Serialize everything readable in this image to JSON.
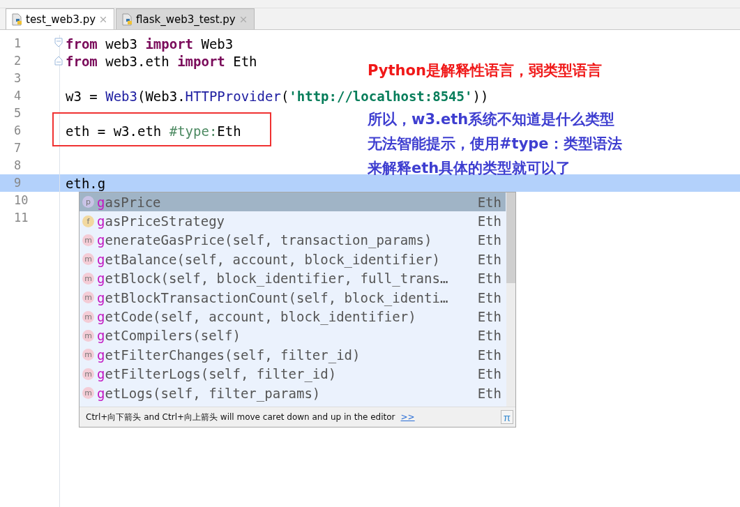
{
  "tabs": [
    {
      "label": "test_web3.py",
      "selected": true
    },
    {
      "label": "flask_web3_test.py",
      "selected": false
    }
  ],
  "editor": {
    "lines": [
      {
        "number": "1",
        "current": false,
        "tokens": [
          {
            "kind": "keyword",
            "text": "from"
          },
          {
            "kind": "plain",
            "text": " web3 "
          },
          {
            "kind": "keyword",
            "text": "import"
          },
          {
            "kind": "plain",
            "text": " Web3"
          }
        ]
      },
      {
        "number": "2",
        "current": false,
        "tokens": [
          {
            "kind": "keyword",
            "text": "from"
          },
          {
            "kind": "plain",
            "text": " web3.eth "
          },
          {
            "kind": "keyword",
            "text": "import"
          },
          {
            "kind": "plain",
            "text": " Eth"
          }
        ]
      },
      {
        "number": "3",
        "current": false
      },
      {
        "number": "4",
        "current": false,
        "tokens": [
          {
            "kind": "plain",
            "text": "w3 = "
          },
          {
            "kind": "call",
            "text": "Web3"
          },
          {
            "kind": "plain",
            "text": "(Web3."
          },
          {
            "kind": "call",
            "text": "HTTPProvider"
          },
          {
            "kind": "plain",
            "text": "("
          },
          {
            "kind": "string",
            "text": "'http://localhost:8545'"
          },
          {
            "kind": "plain",
            "text": "))"
          }
        ]
      },
      {
        "number": "5",
        "current": false
      },
      {
        "number": "6",
        "current": false,
        "tokens": [
          {
            "kind": "plain",
            "text": "eth = w3.eth "
          },
          {
            "kind": "comment",
            "text": "#type:"
          },
          {
            "kind": "plain",
            "text": "Eth"
          }
        ]
      },
      {
        "number": "7",
        "current": false
      },
      {
        "number": "8",
        "current": false
      },
      {
        "number": "9",
        "current": true,
        "tokens": [
          {
            "kind": "plain",
            "text": "eth.g"
          }
        ]
      },
      {
        "number": "10",
        "current": false
      },
      {
        "number": "11",
        "current": false
      }
    ]
  },
  "annotations": [
    {
      "kind": "heading",
      "text": "Python是解释性语言，弱类型语言"
    },
    {
      "kind": "note",
      "text": "所以，w3.eth系统不知道是什么类型"
    },
    {
      "kind": "note",
      "text": "无法智能提示，使用#type：类型语法"
    },
    {
      "kind": "note",
      "text": "来解释eth具体的类型就可以了"
    }
  ],
  "completion": {
    "items": [
      {
        "kind": "p",
        "match": "g",
        "rest": "asPrice",
        "type": "Eth",
        "selected": true
      },
      {
        "kind": "f",
        "match": "g",
        "rest": "asPriceStrategy",
        "type": "Eth",
        "selected": false
      },
      {
        "kind": "m",
        "match": "g",
        "rest": "enerateGasPrice(self, transaction_params)",
        "type": "Eth",
        "selected": false
      },
      {
        "kind": "m",
        "match": "g",
        "rest": "etBalance(self, account, block_identifier)",
        "type": "Eth",
        "selected": false
      },
      {
        "kind": "m",
        "match": "g",
        "rest": "etBlock(self, block_identifier, full_trans…",
        "type": "Eth",
        "selected": false
      },
      {
        "kind": "m",
        "match": "g",
        "rest": "etBlockTransactionCount(self, block_identi…",
        "type": "Eth",
        "selected": false
      },
      {
        "kind": "m",
        "match": "g",
        "rest": "etCode(self, account, block_identifier)",
        "type": "Eth",
        "selected": false
      },
      {
        "kind": "m",
        "match": "g",
        "rest": "etCompilers(self)",
        "type": "Eth",
        "selected": false
      },
      {
        "kind": "m",
        "match": "g",
        "rest": "etFilterChanges(self, filter_id)",
        "type": "Eth",
        "selected": false
      },
      {
        "kind": "m",
        "match": "g",
        "rest": "etFilterLogs(self, filter_id)",
        "type": "Eth",
        "selected": false
      },
      {
        "kind": "m",
        "match": "g",
        "rest": "etLogs(self, filter_params)",
        "type": "Eth",
        "selected": false
      }
    ],
    "hint": "Ctrl+向下箭头 and Ctrl+向上箭头 will move caret down and up in the editor",
    "hint_link": ">>",
    "pi": "π"
  }
}
